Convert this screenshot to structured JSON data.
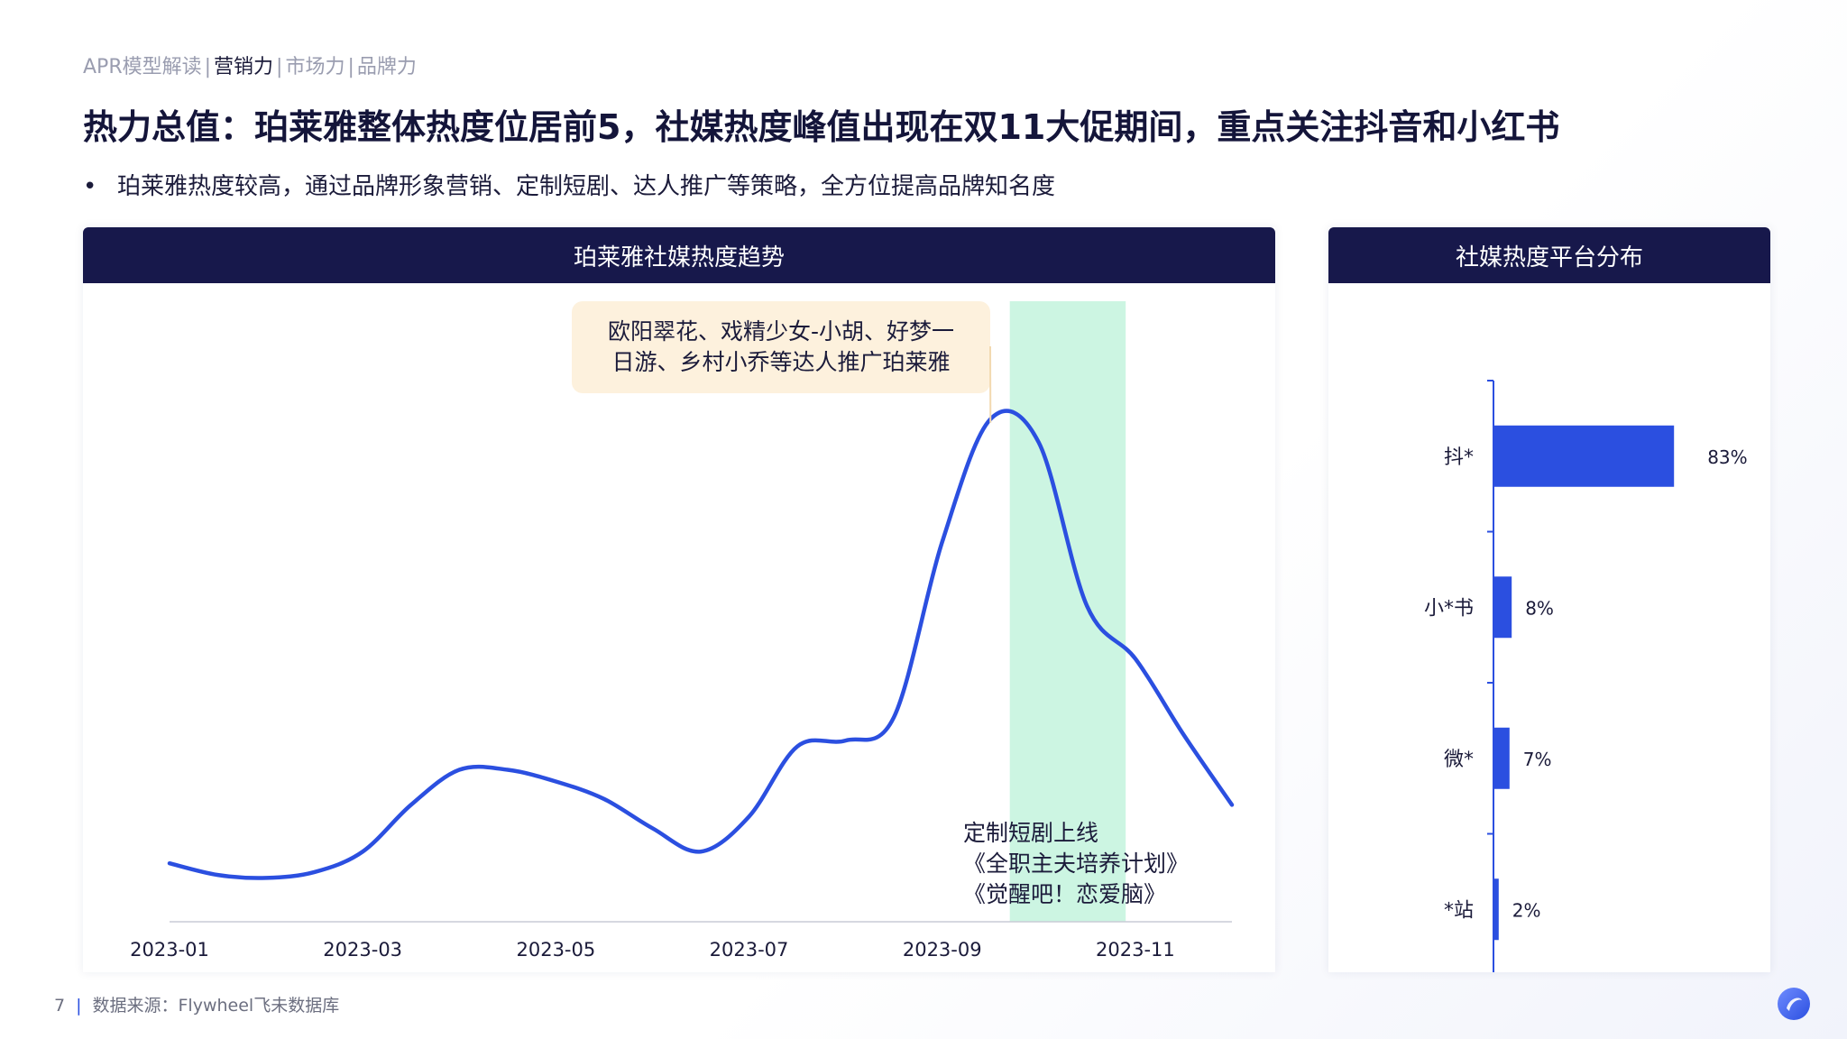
{
  "breadcrumb": {
    "items": [
      "APR模型解读",
      "营销力",
      "市场力",
      "品牌力"
    ],
    "active_index": 1
  },
  "title": "热力总值：珀莱雅整体热度位居前5，社媒热度峰值出现在双11大促期间，重点关注抖音和小红书",
  "bullet": "珀莱雅热度较高，通过品牌形象营销、定制短剧、达人推广等策略，全方位提高品牌知名度",
  "footer": {
    "page_number": "7",
    "source": "数据来源：Flywheel飞未数据库"
  },
  "colors": {
    "navy": "#17184b",
    "accent_blue": "#2b4fe0",
    "highlight_green": "#ccf5e2",
    "callout_bg": "#fdf1dd"
  },
  "chart_data": [
    {
      "type": "line",
      "title": "珀莱雅社媒热度趋势",
      "x_tick_labels": [
        "2023-01",
        "2023-03",
        "2023-05",
        "2023-07",
        "2023-09",
        "2023-11"
      ],
      "x_range": [
        0,
        11
      ],
      "y_range": [
        0,
        100
      ],
      "y_axis_shown": false,
      "series": [
        {
          "x": [
            0,
            0.5,
            1,
            1.5,
            2,
            2.5,
            3,
            3.5,
            4,
            4.5,
            5,
            5.5,
            6,
            6.5,
            7,
            7.5,
            8,
            8.5,
            9,
            9.5,
            10,
            10.5,
            11
          ],
          "values": [
            10,
            8,
            7.5,
            8.5,
            12,
            20,
            26,
            26,
            24,
            21,
            16,
            12,
            18,
            30,
            31,
            35,
            65,
            86,
            82,
            54,
            45,
            32,
            20
          ]
        }
      ],
      "highlight_band": [
        8.7,
        9.9
      ],
      "annotations": [
        {
          "lines": [
            "欧阳翠花、戏精少女-小胡、好梦一",
            "日游、乡村小乔等达人推广珀莱雅"
          ]
        },
        {
          "lines": [
            "定制短剧上线",
            "《全职主夫培养计划》",
            "《觉醒吧！恋爱脑》"
          ]
        }
      ]
    },
    {
      "type": "bar",
      "orientation": "horizontal",
      "title": "社媒热度平台分布",
      "categories": [
        "抖*",
        "小*书",
        "微*",
        "*站"
      ],
      "values": [
        83,
        8,
        7,
        2
      ],
      "value_labels": [
        "83%",
        "8%",
        "7%",
        "2%"
      ],
      "x_range": [
        0,
        100
      ],
      "bar_color": "#2b4fe0"
    }
  ]
}
